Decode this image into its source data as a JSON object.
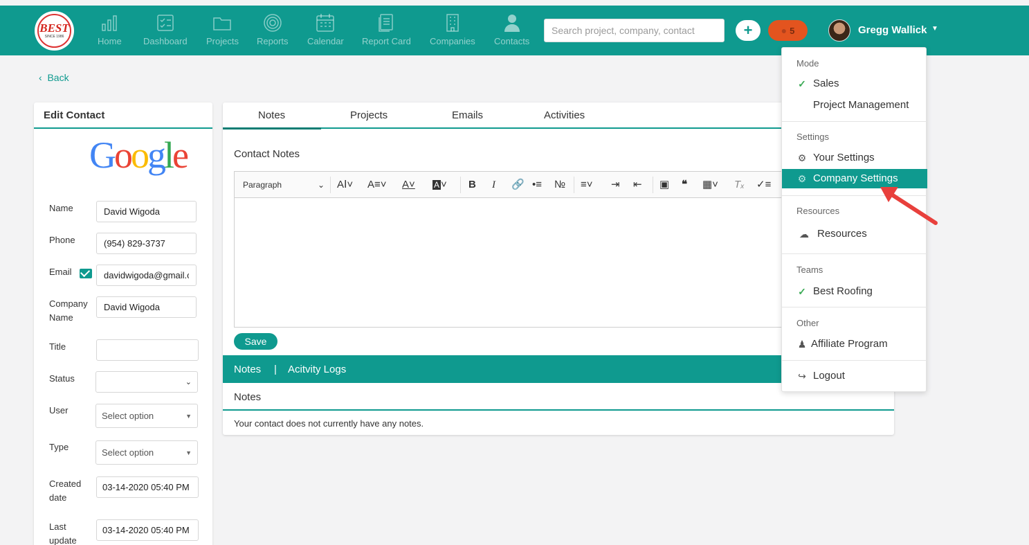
{
  "colors": {
    "teal": "#0f9a8f",
    "orange": "#e3541f",
    "check_green": "#3aaa55",
    "arrow_red": "#e8403c"
  },
  "logo": {
    "text": "BEST",
    "sub": "SINCE 1986"
  },
  "nav": [
    {
      "label": "Home",
      "icon": "bar-chart-icon"
    },
    {
      "label": "Dashboard",
      "icon": "dashboard-icon"
    },
    {
      "label": "Projects",
      "icon": "folder-icon"
    },
    {
      "label": "Reports",
      "icon": "target-icon"
    },
    {
      "label": "Calendar",
      "icon": "calendar-icon"
    },
    {
      "label": "Report Card",
      "icon": "report-card-icon"
    },
    {
      "label": "Companies",
      "icon": "building-icon"
    },
    {
      "label": "Contacts",
      "icon": "person-icon"
    }
  ],
  "search": {
    "placeholder": "Search project, company, contact"
  },
  "header": {
    "plus": "+",
    "notifications": "5",
    "user_name": "Gregg Wallick"
  },
  "back_label": "Back",
  "contact": {
    "title": "Edit Contact",
    "logo_text": "Google",
    "fields": {
      "name": {
        "label": "Name",
        "value": "David Wigoda"
      },
      "phone": {
        "label": "Phone",
        "value": "(954) 829-3737"
      },
      "email": {
        "label": "Email",
        "value": "davidwigoda@gmail.com"
      },
      "company": {
        "label": "Company Name",
        "value": "David Wigoda"
      },
      "title": {
        "label": "Title",
        "value": ""
      },
      "status": {
        "label": "Status",
        "value": ""
      },
      "user": {
        "label": "User",
        "value": "Select option"
      },
      "type": {
        "label": "Type",
        "value": "Select option"
      },
      "created": {
        "label": "Created date",
        "value": "03-14-2020 05:40 PM"
      },
      "updated": {
        "label": "Last update",
        "value": "03-14-2020 05:40 PM"
      }
    }
  },
  "tabs": [
    "Notes",
    "Projects",
    "Emails",
    "Activities"
  ],
  "notes_editor": {
    "title": "Contact Notes",
    "paragraph": "Paragraph",
    "save": "Save"
  },
  "notes_bar": {
    "notes": "Notes",
    "sep": "|",
    "logs": "Acitvity Logs"
  },
  "notes_list": {
    "heading": "Notes",
    "empty": "Your contact does not currently have any notes."
  },
  "menu": {
    "mode": {
      "section": "Mode",
      "sales": "Sales",
      "pm": "Project Management"
    },
    "settings": {
      "section": "Settings",
      "your": "Your Settings",
      "company": "Company Settings"
    },
    "resources": {
      "section": "Resources",
      "item": "Resources"
    },
    "teams": {
      "section": "Teams",
      "item": "Best Roofing"
    },
    "other": {
      "section": "Other",
      "affiliate": "Affiliate Program",
      "logout": "Logout"
    }
  }
}
